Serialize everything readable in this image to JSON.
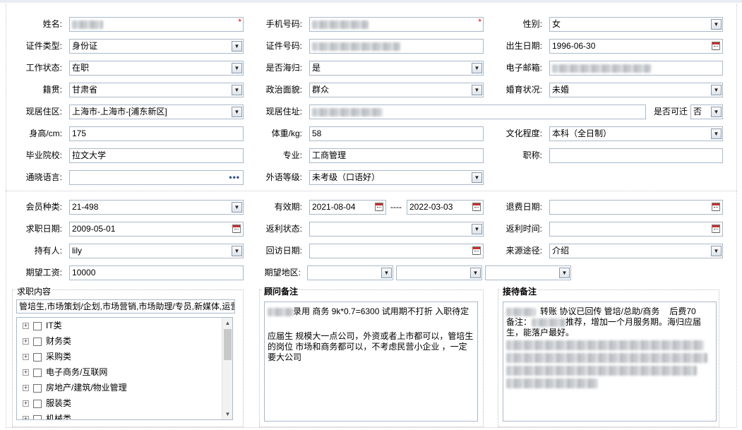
{
  "form": {
    "name": {
      "label": "姓名:",
      "value": ""
    },
    "mobile": {
      "label": "手机号码:",
      "value": ""
    },
    "gender": {
      "label": "性别:",
      "value": "女"
    },
    "id_type": {
      "label": "证件类型:",
      "value": "身份证"
    },
    "id_number": {
      "label": "证件号码:",
      "value": ""
    },
    "birthdate": {
      "label": "出生日期:",
      "value": "1996-06-30"
    },
    "work_status": {
      "label": "工作状态:",
      "value": "在职"
    },
    "returnee": {
      "label": "是否海归:",
      "value": "是"
    },
    "email": {
      "label": "电子邮箱:",
      "value": ""
    },
    "native": {
      "label": "籍贯:",
      "value": "甘肃省"
    },
    "political": {
      "label": "政治面貌:",
      "value": "群众"
    },
    "marital": {
      "label": "婚育状况:",
      "value": "未婚"
    },
    "current_area": {
      "label": "现居住区:",
      "value": "上海市-上海市-[浦东新区]"
    },
    "current_address": {
      "label": "现居住址:",
      "value": ""
    },
    "relocate": {
      "label": "是否可迁",
      "value": "否"
    },
    "height": {
      "label": "身高/cm:",
      "value": "175"
    },
    "weight": {
      "label": "体重/kg:",
      "value": "58"
    },
    "education": {
      "label": "文化程度:",
      "value": "本科（全日制）"
    },
    "school": {
      "label": "毕业院校:",
      "value": "拉文大学"
    },
    "major": {
      "label": "专业:",
      "value": "工商管理"
    },
    "title": {
      "label": "职称:",
      "value": ""
    },
    "languages": {
      "label": "通晓语言:",
      "value": ""
    },
    "lang_level": {
      "label": "外语等级:",
      "value": "未考级（口语好）"
    }
  },
  "membership": {
    "type": {
      "label": "会员种类:",
      "value": "21-498"
    },
    "validity": {
      "label": "有效期:",
      "start": "2021-08-04",
      "sep": "----",
      "end": "2022-03-03"
    },
    "refund_date": {
      "label": "退费日期:",
      "value": ""
    },
    "job_date": {
      "label": "求职日期:",
      "value": "2009-05-01"
    },
    "rebate_status": {
      "label": "返利状态:",
      "value": ""
    },
    "rebate_time": {
      "label": "返利时间:",
      "value": ""
    },
    "holder": {
      "label": "持有人:",
      "value": "lily"
    },
    "revisit_date": {
      "label": "回访日期:",
      "value": ""
    },
    "source": {
      "label": "来源途径:",
      "value": "介绍"
    },
    "salary": {
      "label": "期望工资:",
      "value": "10000"
    },
    "region": {
      "label": "期望地区:",
      "value": ""
    }
  },
  "job_content": {
    "caption": "求职内容",
    "summary": "管培生,市场策划/企划,市场营销,市场助理/专员,新媒体,运营",
    "categories": [
      "IT类",
      "财务类",
      "采购类",
      "电子商务/互联网",
      "房地产/建筑/物业管理",
      "服装类",
      "机械类"
    ]
  },
  "advisor_notes": {
    "caption": "顾问备注",
    "line1": "录用 商务 9k*0.7=6300 试用期不打折 入职待定",
    "line2": "应届生 规模大一点公司，外资或者上市都可以，管培生的岗位 市场和商务都可以，不考虑民营小企业 ，一定要大公司"
  },
  "reception_notes": {
    "caption": "接待备注",
    "line1a": "转账 协议已回传 管培/总助/商务",
    "line1b": "后费70",
    "line2a": "备注：",
    "line2b": "推荐，增加一个月服务期。海归应届生，能落户最好。"
  }
}
